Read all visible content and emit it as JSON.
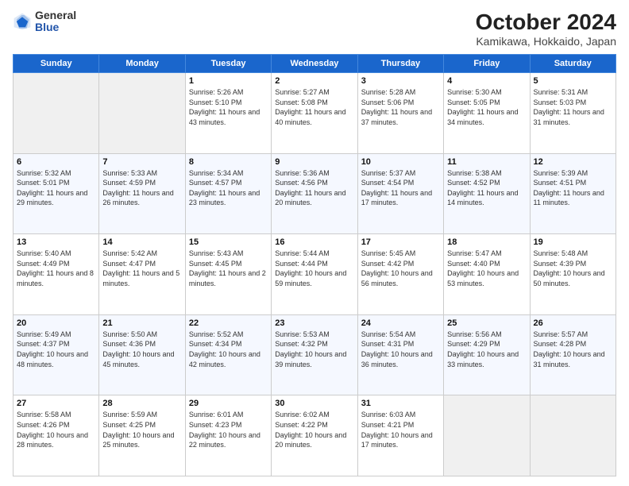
{
  "logo": {
    "general": "General",
    "blue": "Blue"
  },
  "title": "October 2024",
  "subtitle": "Kamikawa, Hokkaido, Japan",
  "days_header": [
    "Sunday",
    "Monday",
    "Tuesday",
    "Wednesday",
    "Thursday",
    "Friday",
    "Saturday"
  ],
  "weeks": [
    [
      {
        "day": "",
        "info": ""
      },
      {
        "day": "",
        "info": ""
      },
      {
        "day": "1",
        "info": "Sunrise: 5:26 AM\nSunset: 5:10 PM\nDaylight: 11 hours and 43 minutes."
      },
      {
        "day": "2",
        "info": "Sunrise: 5:27 AM\nSunset: 5:08 PM\nDaylight: 11 hours and 40 minutes."
      },
      {
        "day": "3",
        "info": "Sunrise: 5:28 AM\nSunset: 5:06 PM\nDaylight: 11 hours and 37 minutes."
      },
      {
        "day": "4",
        "info": "Sunrise: 5:30 AM\nSunset: 5:05 PM\nDaylight: 11 hours and 34 minutes."
      },
      {
        "day": "5",
        "info": "Sunrise: 5:31 AM\nSunset: 5:03 PM\nDaylight: 11 hours and 31 minutes."
      }
    ],
    [
      {
        "day": "6",
        "info": "Sunrise: 5:32 AM\nSunset: 5:01 PM\nDaylight: 11 hours and 29 minutes."
      },
      {
        "day": "7",
        "info": "Sunrise: 5:33 AM\nSunset: 4:59 PM\nDaylight: 11 hours and 26 minutes."
      },
      {
        "day": "8",
        "info": "Sunrise: 5:34 AM\nSunset: 4:57 PM\nDaylight: 11 hours and 23 minutes."
      },
      {
        "day": "9",
        "info": "Sunrise: 5:36 AM\nSunset: 4:56 PM\nDaylight: 11 hours and 20 minutes."
      },
      {
        "day": "10",
        "info": "Sunrise: 5:37 AM\nSunset: 4:54 PM\nDaylight: 11 hours and 17 minutes."
      },
      {
        "day": "11",
        "info": "Sunrise: 5:38 AM\nSunset: 4:52 PM\nDaylight: 11 hours and 14 minutes."
      },
      {
        "day": "12",
        "info": "Sunrise: 5:39 AM\nSunset: 4:51 PM\nDaylight: 11 hours and 11 minutes."
      }
    ],
    [
      {
        "day": "13",
        "info": "Sunrise: 5:40 AM\nSunset: 4:49 PM\nDaylight: 11 hours and 8 minutes."
      },
      {
        "day": "14",
        "info": "Sunrise: 5:42 AM\nSunset: 4:47 PM\nDaylight: 11 hours and 5 minutes."
      },
      {
        "day": "15",
        "info": "Sunrise: 5:43 AM\nSunset: 4:45 PM\nDaylight: 11 hours and 2 minutes."
      },
      {
        "day": "16",
        "info": "Sunrise: 5:44 AM\nSunset: 4:44 PM\nDaylight: 10 hours and 59 minutes."
      },
      {
        "day": "17",
        "info": "Sunrise: 5:45 AM\nSunset: 4:42 PM\nDaylight: 10 hours and 56 minutes."
      },
      {
        "day": "18",
        "info": "Sunrise: 5:47 AM\nSunset: 4:40 PM\nDaylight: 10 hours and 53 minutes."
      },
      {
        "day": "19",
        "info": "Sunrise: 5:48 AM\nSunset: 4:39 PM\nDaylight: 10 hours and 50 minutes."
      }
    ],
    [
      {
        "day": "20",
        "info": "Sunrise: 5:49 AM\nSunset: 4:37 PM\nDaylight: 10 hours and 48 minutes."
      },
      {
        "day": "21",
        "info": "Sunrise: 5:50 AM\nSunset: 4:36 PM\nDaylight: 10 hours and 45 minutes."
      },
      {
        "day": "22",
        "info": "Sunrise: 5:52 AM\nSunset: 4:34 PM\nDaylight: 10 hours and 42 minutes."
      },
      {
        "day": "23",
        "info": "Sunrise: 5:53 AM\nSunset: 4:32 PM\nDaylight: 10 hours and 39 minutes."
      },
      {
        "day": "24",
        "info": "Sunrise: 5:54 AM\nSunset: 4:31 PM\nDaylight: 10 hours and 36 minutes."
      },
      {
        "day": "25",
        "info": "Sunrise: 5:56 AM\nSunset: 4:29 PM\nDaylight: 10 hours and 33 minutes."
      },
      {
        "day": "26",
        "info": "Sunrise: 5:57 AM\nSunset: 4:28 PM\nDaylight: 10 hours and 31 minutes."
      }
    ],
    [
      {
        "day": "27",
        "info": "Sunrise: 5:58 AM\nSunset: 4:26 PM\nDaylight: 10 hours and 28 minutes."
      },
      {
        "day": "28",
        "info": "Sunrise: 5:59 AM\nSunset: 4:25 PM\nDaylight: 10 hours and 25 minutes."
      },
      {
        "day": "29",
        "info": "Sunrise: 6:01 AM\nSunset: 4:23 PM\nDaylight: 10 hours and 22 minutes."
      },
      {
        "day": "30",
        "info": "Sunrise: 6:02 AM\nSunset: 4:22 PM\nDaylight: 10 hours and 20 minutes."
      },
      {
        "day": "31",
        "info": "Sunrise: 6:03 AM\nSunset: 4:21 PM\nDaylight: 10 hours and 17 minutes."
      },
      {
        "day": "",
        "info": ""
      },
      {
        "day": "",
        "info": ""
      }
    ]
  ]
}
